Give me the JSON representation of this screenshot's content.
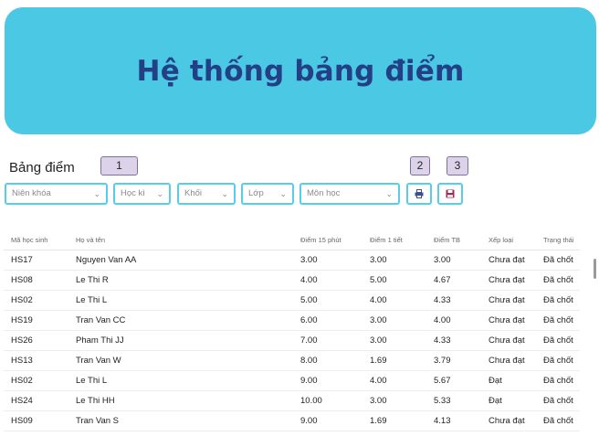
{
  "header": {
    "title": "Hệ thống bảng điểm"
  },
  "section": {
    "title": "Bảng điểm"
  },
  "badges": [
    "1",
    "2",
    "3"
  ],
  "filters": {
    "nien_khoa": "Niên khóa",
    "hoc_ki": "Học kì",
    "khoi": "Khối",
    "lop": "Lớp",
    "mon_hoc": "Môn học"
  },
  "icons": {
    "print": "printer-icon",
    "save": "save-icon"
  },
  "colors": {
    "banner": "#4ac8e4",
    "title": "#233f86",
    "accent_border": "#57cde6"
  },
  "table": {
    "columns": [
      "Mã học sinh",
      "Họ và tên",
      "Điểm 15 phút",
      "Điểm 1 tiết",
      "Điểm TB",
      "Xếp loại",
      "Trạng thái"
    ],
    "rows": [
      [
        "HS17",
        "Nguyen Van AA",
        "3.00",
        "3.00",
        "3.00",
        "Chưa đạt",
        "Đã chốt"
      ],
      [
        "HS08",
        "Le Thi R",
        "4.00",
        "5.00",
        "4.67",
        "Chưa đạt",
        "Đã chốt"
      ],
      [
        "HS02",
        "Le Thi L",
        "5.00",
        "4.00",
        "4.33",
        "Chưa đạt",
        "Đã chốt"
      ],
      [
        "HS19",
        "Tran Van CC",
        "6.00",
        "3.00",
        "4.00",
        "Chưa đạt",
        "Đã chốt"
      ],
      [
        "HS26",
        "Pham Thi JJ",
        "7.00",
        "3.00",
        "4.33",
        "Chưa đạt",
        "Đã chốt"
      ],
      [
        "HS13",
        "Tran Van W",
        "8.00",
        "1.69",
        "3.79",
        "Chưa đạt",
        "Đã chốt"
      ],
      [
        "HS02",
        "Le Thi L",
        "9.00",
        "4.00",
        "5.67",
        "Đạt",
        "Đã chốt"
      ],
      [
        "HS24",
        "Le Thi HH",
        "10.00",
        "3.00",
        "5.33",
        "Đạt",
        "Đã chốt"
      ],
      [
        "HS09",
        "Tran Van S",
        "9.00",
        "1.69",
        "4.13",
        "Chưa đạt",
        "Đã chốt"
      ]
    ]
  }
}
